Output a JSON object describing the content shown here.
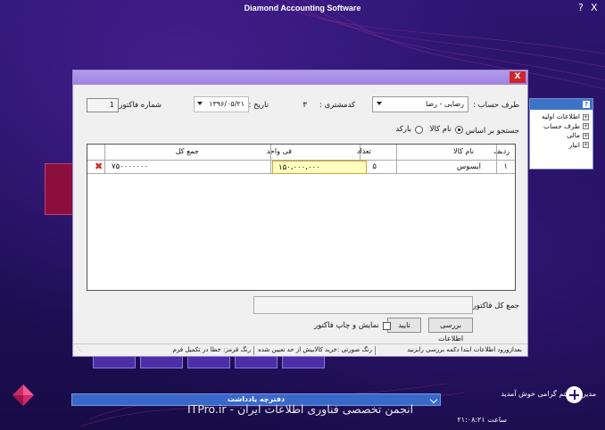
{
  "app": {
    "title": "Diamond Accounting Software"
  },
  "window_controls": {
    "help": "?",
    "close": "X"
  },
  "side_panel": {
    "items": [
      "اطلاعات اولیه",
      "طرف حساب",
      "مالی",
      "انبار"
    ]
  },
  "notes_bar": {
    "title": "دفترچه یادداشت"
  },
  "watermark": {
    "text": "ITPro.ir - انجمن تخصصی فناوری اطلاعات ایران"
  },
  "status": {
    "user": "مدیر سیستم گرامی خوش آمدید",
    "time_label": "ساعت",
    "time": "۲۱:۰۸:۲۱"
  },
  "dialog": {
    "close_label": "X",
    "account_label": "طرف حساب :",
    "account_value": "رضایی - رضا",
    "code_label": "کدمشتری :",
    "code_value": "۳",
    "date_label": "تاریخ :",
    "date_value": "۱۳۹۶/۰۵/۲۱",
    "invoice_no_label": "شماره فاکتور :",
    "invoice_no_value": "1",
    "search_label": "جستجو بر اساس :",
    "search_options": [
      "نام کالا",
      "بارکد"
    ],
    "search_selected": "نام کالا",
    "grid": {
      "headers": [
        "ردیف",
        "نام کالا",
        "تعداد",
        "فی واحد",
        "جمع کل"
      ],
      "rows": [
        {
          "row": "۱",
          "name": "ایسوس",
          "qty": "۵",
          "unit_price": "۱۵۰،۰۰۰،۰۰۰",
          "total": "۷۵۰۰۰۰۰۰۰"
        }
      ]
    },
    "total_label": "جمع کل فاکتور :",
    "review_button": "بررسی اطلاعات",
    "confirm_button": "تایید",
    "print_checkbox_label": "نمایش و چاپ فاکتور",
    "status_messages": [
      "بعدازورود اطلاعات ابتدا دکمه بررسی رابزنید",
      "رنگ صورتی :خرید کالابیش از حد تعیین شده",
      "رنگ قرمز: خطا در تکمیل فرم"
    ]
  }
}
